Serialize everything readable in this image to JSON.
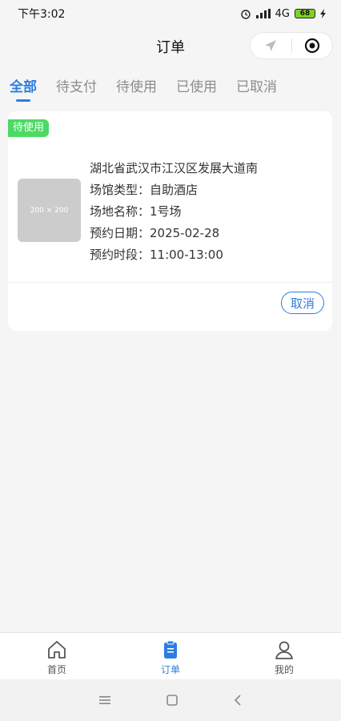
{
  "status_bar": {
    "time": "下午3:02",
    "network": "4G",
    "battery": "68"
  },
  "nav": {
    "title": "订单"
  },
  "tabs": [
    "全部",
    "待支付",
    "待使用",
    "已使用",
    "已取消"
  ],
  "order": {
    "status_badge": "待使用",
    "thumbnail_text": "200 × 200",
    "address": "湖北省武汉市江汉区发展大道南",
    "venue_type": "场馆类型：自助酒店",
    "venue_name": "场地名称：1号场",
    "date": "预约日期：2025-02-28",
    "time_slot": "预约时段：11:00-13:00",
    "cancel_label": "取消"
  },
  "tabbar": [
    {
      "label": "首页",
      "icon": "home-icon"
    },
    {
      "label": "订单",
      "icon": "clipboard-icon"
    },
    {
      "label": "我的",
      "icon": "user-icon"
    }
  ],
  "colors": {
    "accent": "#2d7de0",
    "badge": "#4cd964"
  }
}
